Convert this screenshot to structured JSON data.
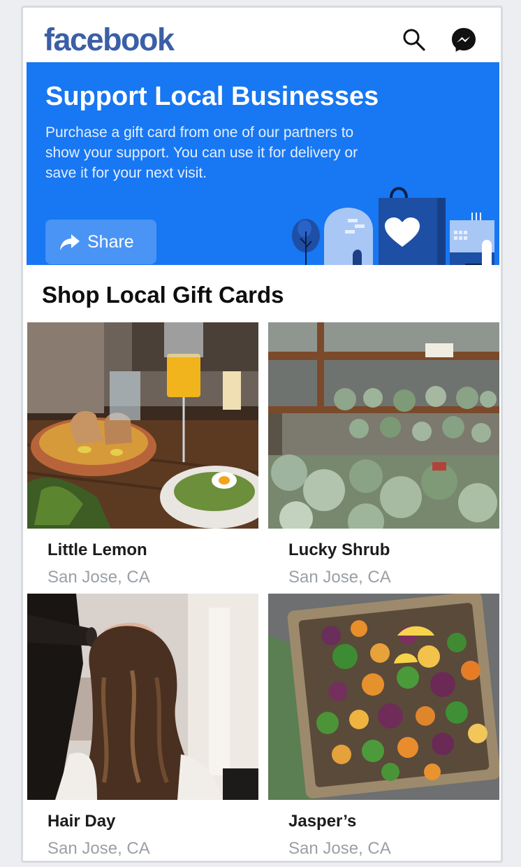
{
  "header": {
    "logo": "facebook",
    "icons": [
      "search-icon",
      "messenger-icon"
    ]
  },
  "banner": {
    "title": "Support Local Businesses",
    "description": "Purchase a gift card from one of our partners to show your support. You can use it for delivery or save it for your next visit.",
    "share_label": "Share",
    "background": "#1877f2"
  },
  "section": {
    "title": "Shop Local Gift Cards"
  },
  "cards": [
    {
      "name": "Little Lemon",
      "location": "San Jose, CA",
      "image": "brunch-plates-photo"
    },
    {
      "name": "Lucky Shrub",
      "location": "San Jose, CA",
      "image": "succulent-plants-photo"
    },
    {
      "name": "Hair Day",
      "location": "San Jose, CA",
      "image": "hair-styling-photo"
    },
    {
      "name": "Jasper’s",
      "location": "San Jose, CA",
      "image": "roasted-vegetables-photo"
    }
  ]
}
